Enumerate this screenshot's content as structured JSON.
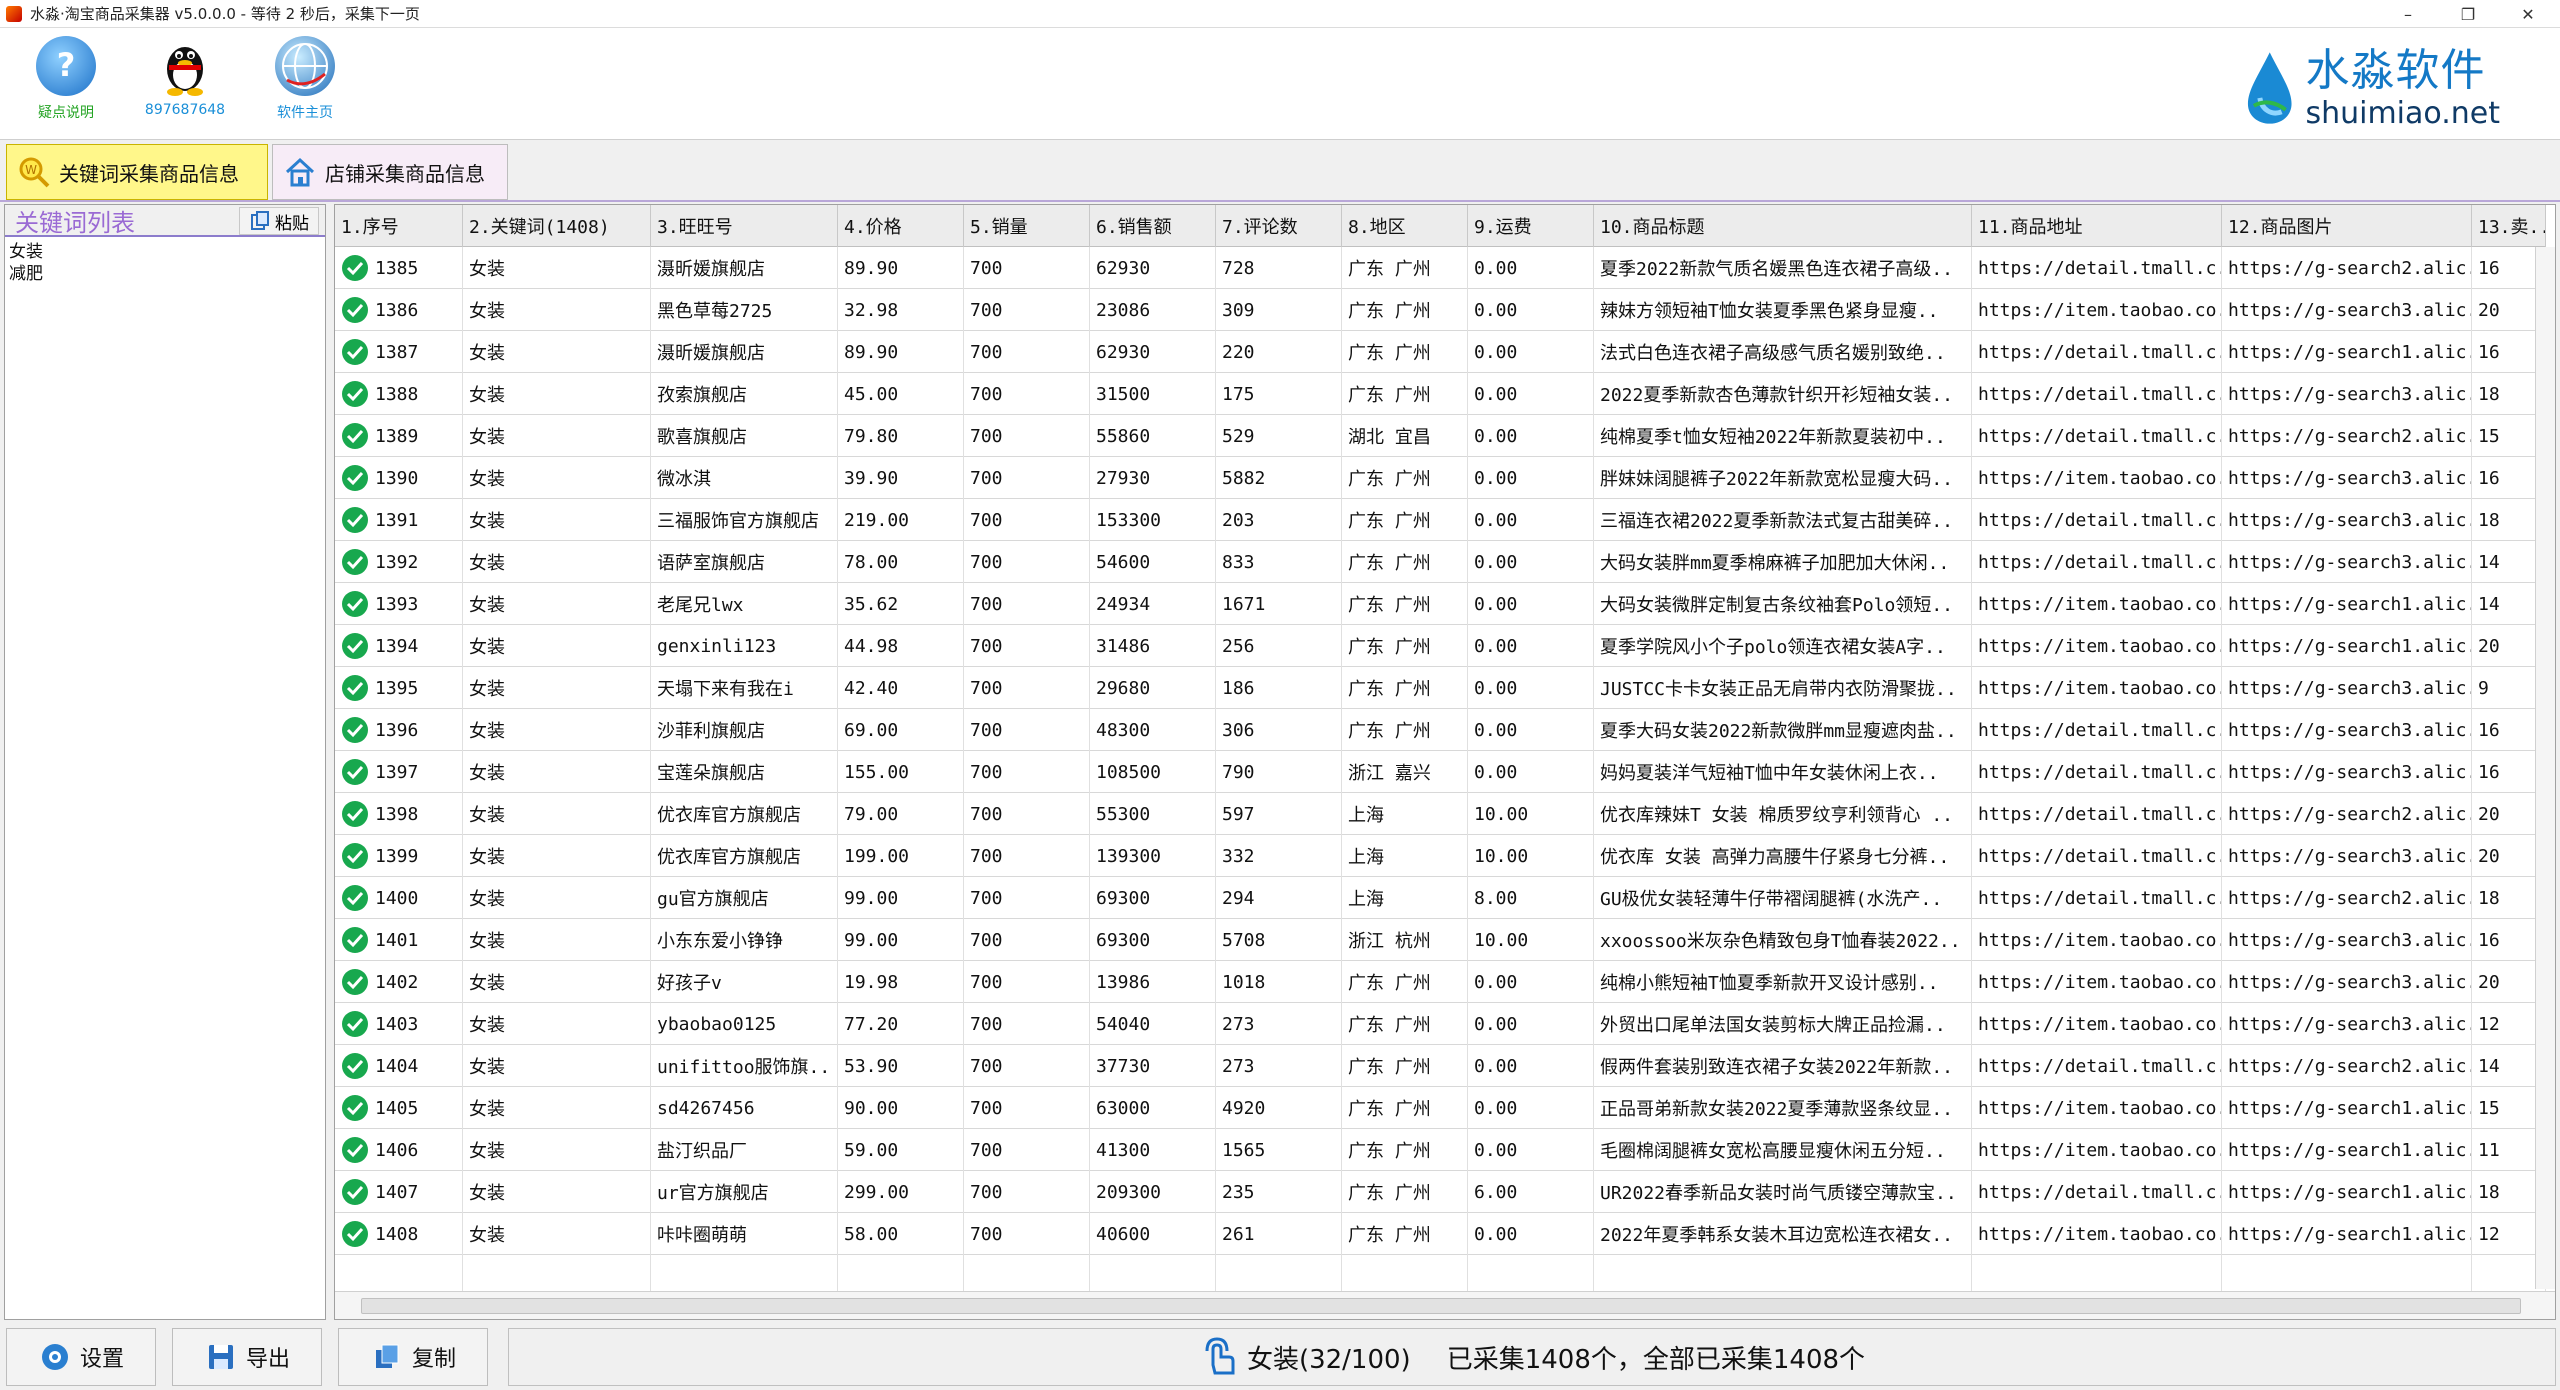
{
  "window": {
    "title": "水淼·淘宝商品采集器 v5.0.0.0 - 等待 2 秒后，采集下一页",
    "minimize": "–",
    "maximize": "❐",
    "close": "✕"
  },
  "toolbar": {
    "help_label": "疑点说明",
    "qq_label": "897687648",
    "home_label": "软件主页"
  },
  "brand": {
    "cn": "水淼软件",
    "en": "shuimiao.net"
  },
  "tabs": {
    "keyword": "关键词采集商品信息",
    "shop": "店铺采集商品信息"
  },
  "keywords": {
    "title": "关键词列表",
    "paste_label": "粘贴",
    "items": [
      "女装",
      "减肥"
    ]
  },
  "grid": {
    "columns": [
      "1.序号",
      "2.关键词(1408)",
      "3.旺旺号",
      "4.价格",
      "5.销量",
      "6.销售额",
      "7.评论数",
      "8.地区",
      "9.运费",
      "10.商品标题",
      "11.商品地址",
      "12.商品图片",
      "13.卖.."
    ],
    "rows": [
      [
        "1385",
        "女装",
        "滠昕媛旗舰店",
        "89.90",
        "700",
        "62930",
        "728",
        "广东 广州",
        "0.00",
        "夏季2022新款气质名媛黑色连衣裙子高级..",
        "https://detail.tmall.c..",
        "https://g-search2.alic..",
        "16"
      ],
      [
        "1386",
        "女装",
        "黑色草莓2725",
        "32.98",
        "700",
        "23086",
        "309",
        "广东 广州",
        "0.00",
        "辣妹方领短袖T恤女装夏季黑色紧身显瘦..",
        "https://item.taobao.co..",
        "https://g-search3.alic..",
        "20"
      ],
      [
        "1387",
        "女装",
        "滠昕媛旗舰店",
        "89.90",
        "700",
        "62930",
        "220",
        "广东 广州",
        "0.00",
        "法式白色连衣裙子高级感气质名媛别致绝..",
        "https://detail.tmall.c..",
        "https://g-search1.alic..",
        "16"
      ],
      [
        "1388",
        "女装",
        "孜索旗舰店",
        "45.00",
        "700",
        "31500",
        "175",
        "广东 广州",
        "0.00",
        "2022夏季新款杏色薄款针织开衫短袖女装..",
        "https://detail.tmall.c..",
        "https://g-search3.alic..",
        "18"
      ],
      [
        "1389",
        "女装",
        "歌喜旗舰店",
        "79.80",
        "700",
        "55860",
        "529",
        "湖北 宜昌",
        "0.00",
        "纯棉夏季t恤女短袖2022年新款夏装初中..",
        "https://detail.tmall.c..",
        "https://g-search2.alic..",
        "15"
      ],
      [
        "1390",
        "女装",
        "微冰淇",
        "39.90",
        "700",
        "27930",
        "5882",
        "广东 广州",
        "0.00",
        "胖妹妹阔腿裤子2022年新款宽松显瘦大码..",
        "https://item.taobao.co..",
        "https://g-search3.alic..",
        "16"
      ],
      [
        "1391",
        "女装",
        "三福服饰官方旗舰店",
        "219.00",
        "700",
        "153300",
        "203",
        "广东 广州",
        "0.00",
        "三福连衣裙2022夏季新款法式复古甜美碎..",
        "https://detail.tmall.c..",
        "https://g-search3.alic..",
        "18"
      ],
      [
        "1392",
        "女装",
        "语萨室旗舰店",
        "78.00",
        "700",
        "54600",
        "833",
        "广东 广州",
        "0.00",
        "大码女装胖mm夏季棉麻裤子加肥加大休闲..",
        "https://detail.tmall.c..",
        "https://g-search3.alic..",
        "14"
      ],
      [
        "1393",
        "女装",
        "老尾兄lwx",
        "35.62",
        "700",
        "24934",
        "1671",
        "广东 广州",
        "0.00",
        "大码女装微胖定制复古条纹袖套Polo领短..",
        "https://item.taobao.co..",
        "https://g-search1.alic..",
        "14"
      ],
      [
        "1394",
        "女装",
        "genxinli123",
        "44.98",
        "700",
        "31486",
        "256",
        "广东 广州",
        "0.00",
        "夏季学院风小个子polo领连衣裙女装A字..",
        "https://item.taobao.co..",
        "https://g-search1.alic..",
        "20"
      ],
      [
        "1395",
        "女装",
        "天塌下来有我在i",
        "42.40",
        "700",
        "29680",
        "186",
        "广东 广州",
        "0.00",
        "JUSTCC卡卡女装正品无肩带内衣防滑聚拢..",
        "https://item.taobao.co..",
        "https://g-search3.alic..",
        "9"
      ],
      [
        "1396",
        "女装",
        "沙菲利旗舰店",
        "69.00",
        "700",
        "48300",
        "306",
        "广东 广州",
        "0.00",
        "夏季大码女装2022新款微胖mm显瘦遮肉盐..",
        "https://detail.tmall.c..",
        "https://g-search3.alic..",
        "16"
      ],
      [
        "1397",
        "女装",
        "宝莲朵旗舰店",
        "155.00",
        "700",
        "108500",
        "790",
        "浙江 嘉兴",
        "0.00",
        "妈妈夏装洋气短袖T恤中年女装休闲上衣..",
        "https://detail.tmall.c..",
        "https://g-search3.alic..",
        "16"
      ],
      [
        "1398",
        "女装",
        "优衣库官方旗舰店",
        "79.00",
        "700",
        "55300",
        "597",
        "上海",
        "10.00",
        "优衣库辣妹T 女装 棉质罗纹亨利领背心 ..",
        "https://detail.tmall.c..",
        "https://g-search2.alic..",
        "20"
      ],
      [
        "1399",
        "女装",
        "优衣库官方旗舰店",
        "199.00",
        "700",
        "139300",
        "332",
        "上海",
        "10.00",
        "优衣库 女装 高弹力高腰牛仔紧身七分裤..",
        "https://detail.tmall.c..",
        "https://g-search3.alic..",
        "20"
      ],
      [
        "1400",
        "女装",
        "gu官方旗舰店",
        "99.00",
        "700",
        "69300",
        "294",
        "上海",
        "8.00",
        "GU极优女装轻薄牛仔带褶阔腿裤(水洗产..",
        "https://detail.tmall.c..",
        "https://g-search2.alic..",
        "18"
      ],
      [
        "1401",
        "女装",
        "小东东爱小铮铮",
        "99.00",
        "700",
        "69300",
        "5708",
        "浙江 杭州",
        "10.00",
        "xxoossoo米灰杂色精致包身T恤春装2022..",
        "https://item.taobao.co..",
        "https://g-search3.alic..",
        "16"
      ],
      [
        "1402",
        "女装",
        "好孩子v",
        "19.98",
        "700",
        "13986",
        "1018",
        "广东 广州",
        "0.00",
        "纯棉小熊短袖T恤夏季新款开叉设计感别..",
        "https://item.taobao.co..",
        "https://g-search3.alic..",
        "20"
      ],
      [
        "1403",
        "女装",
        "ybaobao0125",
        "77.20",
        "700",
        "54040",
        "273",
        "广东 广州",
        "0.00",
        "外贸出口尾单法国女装剪标大牌正品捡漏..",
        "https://item.taobao.co..",
        "https://g-search3.alic..",
        "12"
      ],
      [
        "1404",
        "女装",
        "unifittoo服饰旗..",
        "53.90",
        "700",
        "37730",
        "273",
        "广东 广州",
        "0.00",
        "假两件套装别致连衣裙子女装2022年新款..",
        "https://detail.tmall.c..",
        "https://g-search2.alic..",
        "14"
      ],
      [
        "1405",
        "女装",
        "sd4267456",
        "90.00",
        "700",
        "63000",
        "4920",
        "广东 广州",
        "0.00",
        "正品哥弟新款女装2022夏季薄款竖条纹显..",
        "https://item.taobao.co..",
        "https://g-search1.alic..",
        "15"
      ],
      [
        "1406",
        "女装",
        "盐汀织品厂",
        "59.00",
        "700",
        "41300",
        "1565",
        "广东 广州",
        "0.00",
        "毛圈棉阔腿裤女宽松高腰显瘦休闲五分短..",
        "https://item.taobao.co..",
        "https://g-search1.alic..",
        "11"
      ],
      [
        "1407",
        "女装",
        "ur官方旗舰店",
        "299.00",
        "700",
        "209300",
        "235",
        "广东 广州",
        "6.00",
        "UR2022春季新品女装时尚气质镂空薄款宝..",
        "https://detail.tmall.c..",
        "https://g-search1.alic..",
        "18"
      ],
      [
        "1408",
        "女装",
        "咔咔圈萌萌",
        "58.00",
        "700",
        "40600",
        "261",
        "广东 广州",
        "0.00",
        "2022年夏季韩系女装木耳边宽松连衣裙女..",
        "https://item.taobao.co..",
        "https://g-search1.alic..",
        "12"
      ]
    ]
  },
  "bottom": {
    "settings_label": "设置",
    "export_label": "导出",
    "copy_label": "复制",
    "status_keyword": "女装(32/100)",
    "status_text": "已采集1408个，全部已采集1408个"
  },
  "colors": {
    "accent_blue": "#1479c6",
    "active_tab": "#fff78a",
    "check_green": "#18a84e",
    "keyword_title": "#9a6ad4"
  },
  "icons": [
    "help-icon",
    "qq-penguin-icon",
    "globe-icon",
    "search-icon",
    "home-icon",
    "paste-icon",
    "checkmark-icon",
    "gear-icon",
    "save-icon",
    "copy-icon",
    "tap-icon"
  ]
}
